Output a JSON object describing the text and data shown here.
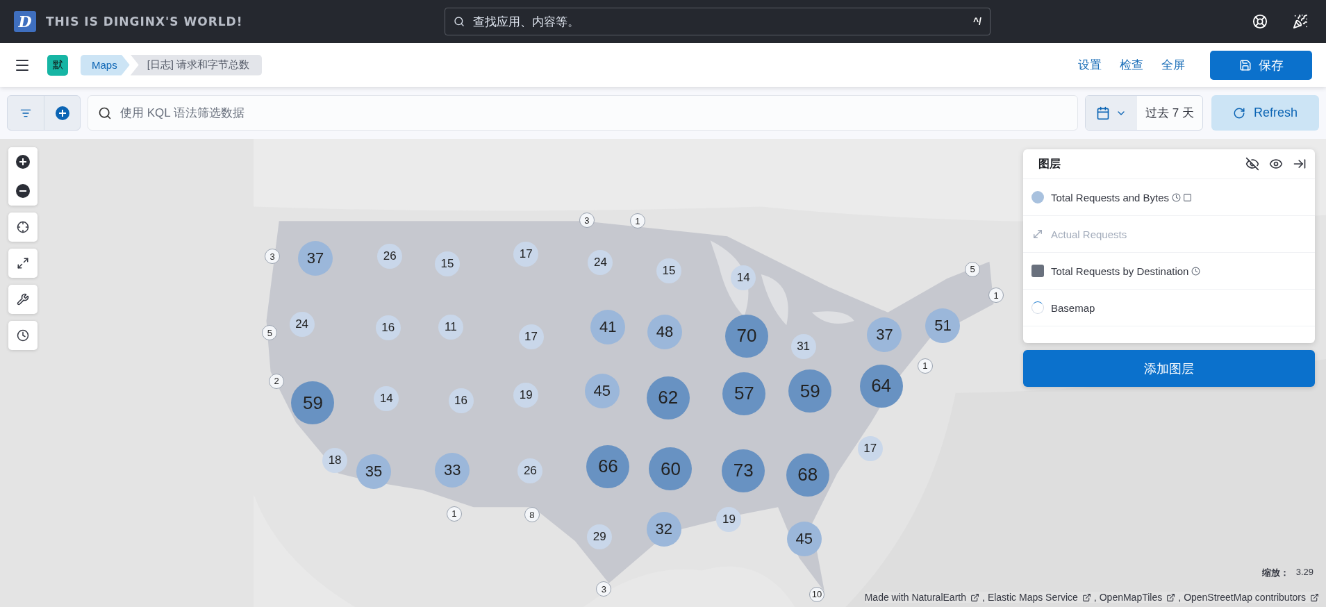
{
  "header": {
    "logo": "D",
    "title": "THIS IS DINGINX'S WORLD!",
    "search": {
      "placeholder": "查找应用、内容等。",
      "shortcut": "^/"
    }
  },
  "nav": {
    "avatar": "默",
    "breadcrumbs": [
      {
        "label": "Maps",
        "selected": true
      },
      {
        "label": "[日志] 请求和字节总数",
        "selected": false
      }
    ],
    "links": [
      "设置",
      "检查",
      "全屏"
    ],
    "save_button": "保存"
  },
  "query": {
    "placeholder": "使用 KQL 语法筛选数据",
    "time_range": "过去 7 天",
    "refresh_button": "Refresh"
  },
  "clusters": [
    {
      "value": "3",
      "kind": "tiny"
    },
    {
      "value": "37",
      "kind": "large"
    },
    {
      "value": "26",
      "kind": "medium"
    },
    {
      "value": "15",
      "kind": "medium"
    },
    {
      "value": "17",
      "kind": "medium"
    },
    {
      "value": "24",
      "kind": "medium"
    },
    {
      "value": "3",
      "kind": "tiny"
    },
    {
      "value": "1",
      "kind": "tiny"
    },
    {
      "value": "15",
      "kind": "medium"
    },
    {
      "value": "14",
      "kind": "medium"
    },
    {
      "value": "5",
      "kind": "tiny"
    },
    {
      "value": "1",
      "kind": "tiny"
    },
    {
      "value": "24",
      "kind": "medium"
    },
    {
      "value": "5",
      "kind": "tiny"
    },
    {
      "value": "16",
      "kind": "medium"
    },
    {
      "value": "11",
      "kind": "medium"
    },
    {
      "value": "17",
      "kind": "medium"
    },
    {
      "value": "41",
      "kind": "large"
    },
    {
      "value": "48",
      "kind": "large"
    },
    {
      "value": "70",
      "kind": "xlarge"
    },
    {
      "value": "31",
      "kind": "medium"
    },
    {
      "value": "37",
      "kind": "large"
    },
    {
      "value": "51",
      "kind": "large"
    },
    {
      "value": "1",
      "kind": "tiny"
    },
    {
      "value": "2",
      "kind": "tiny"
    },
    {
      "value": "59",
      "kind": "xlarge"
    },
    {
      "value": "14",
      "kind": "medium"
    },
    {
      "value": "16",
      "kind": "medium"
    },
    {
      "value": "19",
      "kind": "medium"
    },
    {
      "value": "45",
      "kind": "large"
    },
    {
      "value": "62",
      "kind": "xlarge"
    },
    {
      "value": "57",
      "kind": "xlarge"
    },
    {
      "value": "59",
      "kind": "xlarge"
    },
    {
      "value": "64",
      "kind": "xlarge"
    },
    {
      "value": "17",
      "kind": "medium"
    },
    {
      "value": "18",
      "kind": "medium"
    },
    {
      "value": "35",
      "kind": "large"
    },
    {
      "value": "33",
      "kind": "large"
    },
    {
      "value": "26",
      "kind": "medium"
    },
    {
      "value": "66",
      "kind": "xlarge"
    },
    {
      "value": "60",
      "kind": "xlarge"
    },
    {
      "value": "73",
      "kind": "xlarge"
    },
    {
      "value": "68",
      "kind": "xlarge"
    },
    {
      "value": "1",
      "kind": "tiny"
    },
    {
      "value": "8",
      "kind": "tiny"
    },
    {
      "value": "19",
      "kind": "medium"
    },
    {
      "value": "29",
      "kind": "medium"
    },
    {
      "value": "32",
      "kind": "large"
    },
    {
      "value": "45",
      "kind": "large"
    },
    {
      "value": "3",
      "kind": "tiny"
    },
    {
      "value": "10",
      "kind": "tiny"
    }
  ],
  "layers": {
    "title": "图层",
    "items": [
      {
        "name": "Total Requests and Bytes",
        "kind": "circle",
        "color": "#a8c1de",
        "disabled": false,
        "time_filtered": true,
        "masked": true
      },
      {
        "name": "Actual Requests",
        "kind": "arrows",
        "disabled": true,
        "time_filtered": false,
        "masked": false
      },
      {
        "name": "Total Requests by Destination",
        "kind": "square",
        "color": "#69707d",
        "disabled": false,
        "time_filtered": true,
        "masked": false
      },
      {
        "name": "Basemap",
        "kind": "loading",
        "disabled": false,
        "time_filtered": false,
        "masked": false
      }
    ],
    "add_button": "添加图层"
  },
  "zoom": {
    "label": "缩放：",
    "value": "3.29"
  },
  "attribution": [
    "Made with NaturalEarth",
    "Elastic Maps Service",
    "OpenMapTiles",
    "OpenStreetMap contributors"
  ],
  "attribution_separator": ","
}
